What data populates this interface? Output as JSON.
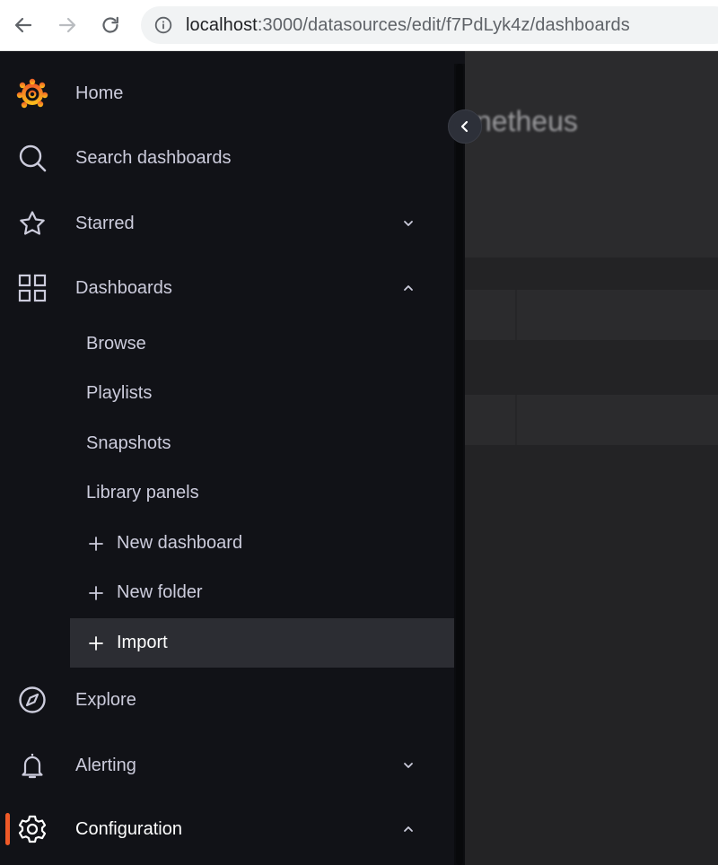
{
  "browser": {
    "url_host": "localhost",
    "url_path": ":3000/datasources/edit/f7PdLyk4z/dashboards"
  },
  "page": {
    "title": "netheus"
  },
  "menu": {
    "home": "Home",
    "search": "Search dashboards",
    "starred": "Starred",
    "dashboards": "Dashboards",
    "dashboards_children": {
      "browse": "Browse",
      "playlists": "Playlists",
      "snapshots": "Snapshots",
      "library_panels": "Library panels",
      "new_dashboard": "New dashboard",
      "new_folder": "New folder",
      "import": "Import"
    },
    "explore": "Explore",
    "alerting": "Alerting",
    "configuration": "Configuration"
  },
  "colors": {
    "accent": "#f05a28",
    "menu_bg": "#111217",
    "text": "#ccccdc"
  }
}
